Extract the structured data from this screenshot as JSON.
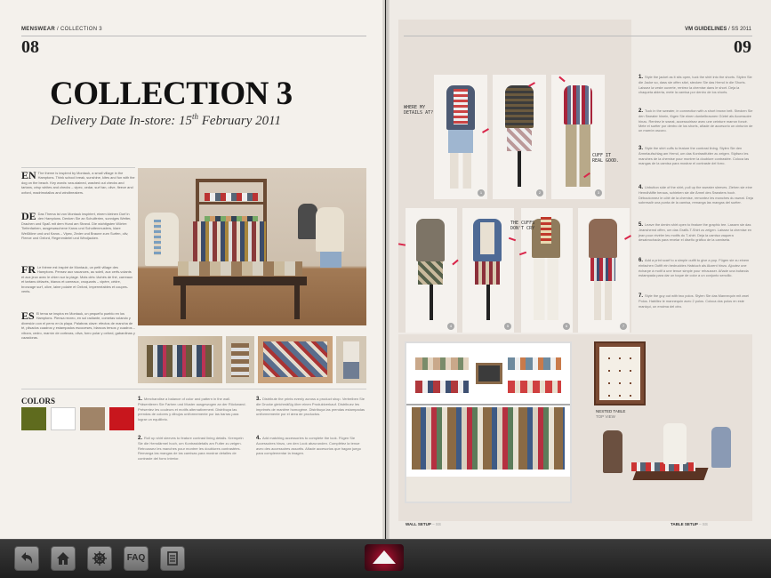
{
  "left_page": {
    "header_brand": "MENSWEAR",
    "header_sep": " / ",
    "header_section": "COLLECTION 3",
    "page_number": "08",
    "title": "COLLECTION 3",
    "subtitle_prefix": "Delivery Date In-store: 15",
    "subtitle_sup": "th",
    "subtitle_suffix": " February 2011",
    "languages": [
      {
        "code": "EN",
        "text": "The theme is inspired by Montauk, a small village in the Hamptons. Think school break, sunshine, kites and fun with the dog on the beach. Key words: sea-stained, washed out checks and tartans, crisp whites and checks – vipec, cedar, surf tan, olive, fleece and oxford, madrimotallos and windbreakers."
      },
      {
        "code": "DE",
        "text": "Das Thema ist von Montauk inspiriert, einem kleinen Dorf in den Hamptons. Denken Sie an Schulferien, sonniges Wetter, Drachen und Spaß mit dem Hund am Strand. Die wichtigsten Wörter: Tiefenfarben, ausgewaschene Karos und Schottenmusters, klare Weißtöne und und Karos – Vipec, Zeder und Braune zum Surfen, oliv, Fleece und Oxford, Regenmäntel und Windjacken."
      },
      {
        "code": "FR",
        "text": "Le thème est inspiré de Montauk, un petit village des Hamptons. Pensez aux vacances, au soleil, aux cerfs-volants et aux jeux avec le chien sur la plage. Mots clés: lâchés de thé, carreaux et tartans délavés, blancs et carreaux, croquants – vipère, cèdre, bronzage surf, olive, laine polaire et Oxford, imperméables et coupes-vents."
      },
      {
        "code": "ES",
        "text": "El tema se inspira en Montauk, un pequeño pueblo en los Hamptons. Piensa recreo, en sol radiante, cometas volando y diversión con el perro en la playa. Palabras clave: efectos de mancha de té, plisados cuadros y estampados escoceses, blancos tersos y cuadros – víbora, cedro, marrón de cortezas, oliva, forro polar y oxford, gabardinas y cazadoras."
      }
    ],
    "colors_label": "COLORS",
    "colors": [
      "#5f6b1e",
      "#ffffff",
      "#a08468",
      "#c8161d"
    ],
    "notes": [
      {
        "num": "1.",
        "text": "Merchandise a balance of color and pattern in the wall. Präsentieren Sie Farben und Muster ausgewogen an der Rückwand. Présentez les couleurs et motifs alternativement. Distribuya las prendas de colores y dibujos uniformemente por las barras para lograr un equilibrio."
      },
      {
        "num": "2.",
        "text": "Roll up shirt sleeves to feature contrast lining details. Krempeln Sie die Hemdärmel hoch, um Kontrastdetails am Futter zu zeigen. Retroussez les manches pour montrer les doublures contrastées. Remanga las mangas de las camisas para mostrar detalles de contraste del forro interior."
      },
      {
        "num": "3.",
        "text": "Distribute the prints evenly across a product shop. Vertreiben Sie die Drucke gleichmäßig über einen Produktverkauf. Distribuez les imprimés de manière homogène. Distribuya las prendas estampadas uniformemente por el área de productos."
      },
      {
        "num": "4.",
        "text": "Add matching accessories to complete the look. Fügen Sie Accessoires hinzu, um den Look abzurunden. Complétez la tenue avec des accessoires assortis. Añade accesorios que hagan juego para complementar la imagen."
      }
    ]
  },
  "right_page": {
    "header_brand": "VM GUIDELINES",
    "header_sep": " / ",
    "header_section": "SS 2011",
    "page_number": "09",
    "annotations": {
      "where": "WHERE MY\nDETAILS AT?",
      "cuff": "CUFF IT\nREAL GOOD.",
      "cuffs": "THE CUFFS\nDON'T CRY"
    },
    "steps": [
      {
        "num": "1.",
        "text": "Style the jacket as it sits open, tuck the shirt into the shorts. Stylen Sie die Jacke so, dass sie offen sitzt, stecken Sie das Hemd in die Shorts. Laissez la veste ouverte, rentrez la chemise dans le short. Deja la chaqueta abierta, mete la camisa por dentro de los shorts."
      },
      {
        "num": "2.",
        "text": "Tuck in the sweater, in connection with a short brown belt. Stecken Sie den Sweater hinein, fügen Sie einen dunkelbraunen Gürtel als Accessoire hinzu. Rentrez le sweat, accessoirisez avec une ceinture marron foncé. Mete el suéter por dentro de los shorts, añade de accesorio un cinturón de un marrón oscuro."
      },
      {
        "num": "3.",
        "text": "Style the shirt cuffs to feature the contrast lining. Stylen Sie den Ärmelaufschlag am Hemd, um das Kontrastfutter zu zeigen. Stylisez les manches de la chemise pour montrer la doublure contrastée. Coloca las mangas de la camisa para mostrar el contraste del forro."
      },
      {
        "num": "4.",
        "text": "Unbutton side of the shirt, pull up the sweater sleeves. Ziehen sie eine Hemdhälfte heraus, schieben sie die Ärmel des Sweaters hoch. Déboutonnez le côté de la chemise, remontez les manches du sweat. Deja sobresalir una punta de la camisa, remanga las mangas del suéter."
      },
      {
        "num": "5.",
        "text": "Leave the denim shirt open to feature the graphic tee. Lassen sie das Jeanshemd offen, um das Grafik-T-Shirt zu zeigen. Laissez la chemise en jean pour révéler les motifs du T-shirt. Deja la camisa vaquera desabrochada para revelar el diseño gráfico de la camiseta."
      },
      {
        "num": "6.",
        "text": "Add a print scarf to a simple outfit to give a pop. Fügen sie zu einem einfachen Outfit ein bedrucktes Halstuch als Akzent hinzu. Ajoutez une écharpe à motif à une tenue simple pour rehausser. Añade una bufanda estampada para dar un toque de color a un conjunto sencillo."
      },
      {
        "num": "7.",
        "text": "Style the guy out with two polos. Stylen Sie das Mannequin mit zwei Polos. Habillez le mannequin avec 2 polos. Coloca dos polos en este maniquí, un encima del otro."
      }
    ],
    "nested_table_label": "NESTED TABLE",
    "top_view_label": "TOP VIEW",
    "wall_setup_label": "WALL SETUP",
    "wall_setup_suffix": " – SS",
    "table_setup_label": "TABLE SETUP",
    "table_setup_suffix": " – SS"
  },
  "toolbar": {
    "back_icon": "back-arrow-icon",
    "home_icon": "home-icon",
    "settings_icon": "ship-wheel-icon",
    "faq_label": "FAQ",
    "notes_icon": "notepad-icon",
    "expand_icon": "up-triangle-icon"
  }
}
